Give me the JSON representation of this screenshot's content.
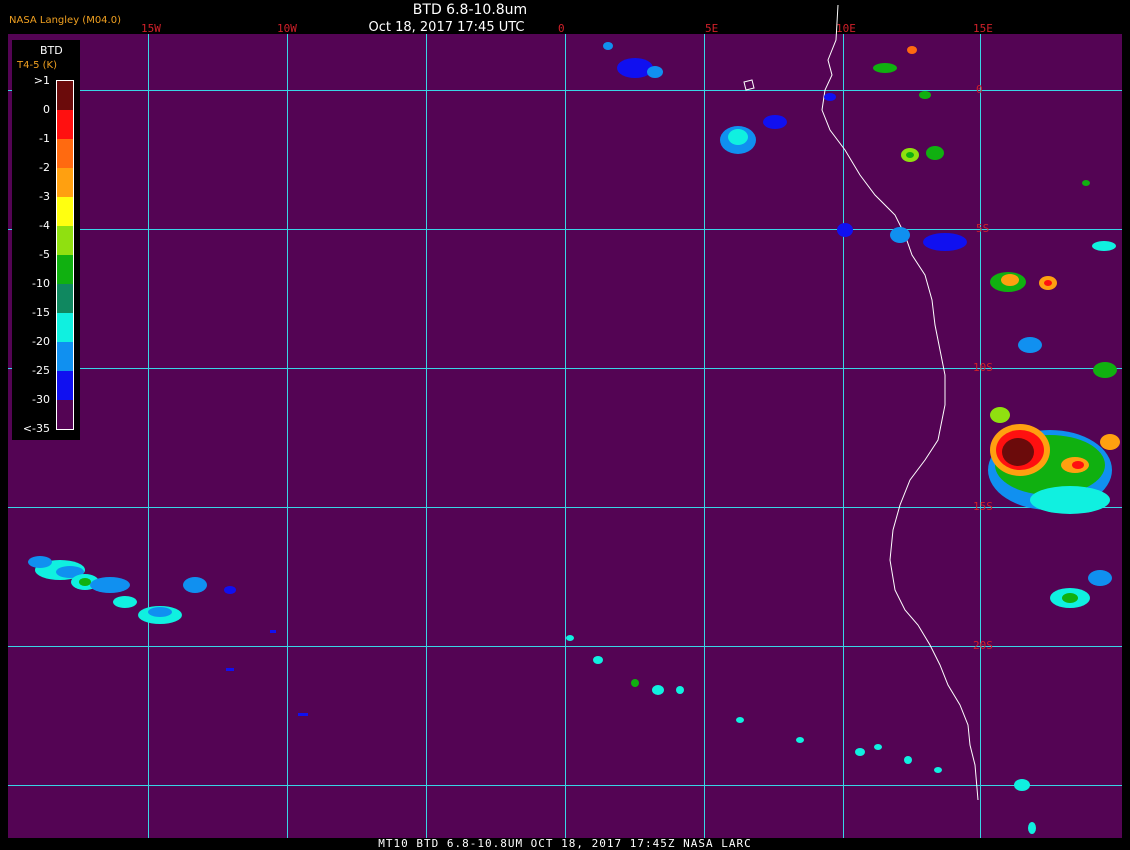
{
  "header": {
    "agency": "NASA Langley (M04.0)",
    "title": "BTD 6.8-10.8um",
    "subtitle": "Oct 18, 2017 17:45 UTC"
  },
  "footer": {
    "text": "MT10  BTD 6.8-10.8UM   OCT 18, 2017 17:45Z   NASA LARC"
  },
  "legend": {
    "title": "BTD",
    "subtitle": "T4-5 (K)",
    "ticks": [
      ">1",
      "0",
      "-1",
      "-2",
      "-3",
      "-4",
      "-5",
      "-10",
      "-15",
      "-20",
      "-25",
      "-30",
      "<-35"
    ],
    "colors": [
      "#6b0b0b",
      "#ff1010",
      "#ff6a10",
      "#ffa010",
      "#ffff10",
      "#90e010",
      "#10b010",
      "#108860",
      "#10f0e0",
      "#1090f0",
      "#1010f0",
      "#540454"
    ]
  },
  "grid": {
    "longitudes": [
      "15W",
      "10W",
      "5W",
      "0",
      "5E",
      "10E",
      "15E"
    ],
    "latitudes": [
      "0",
      "5S",
      "10S",
      "15S",
      "20S"
    ]
  },
  "colors": {
    "background": "#540454",
    "grid": "#39d6e6",
    "coast": "#ffffff",
    "label": "#d0202a"
  }
}
